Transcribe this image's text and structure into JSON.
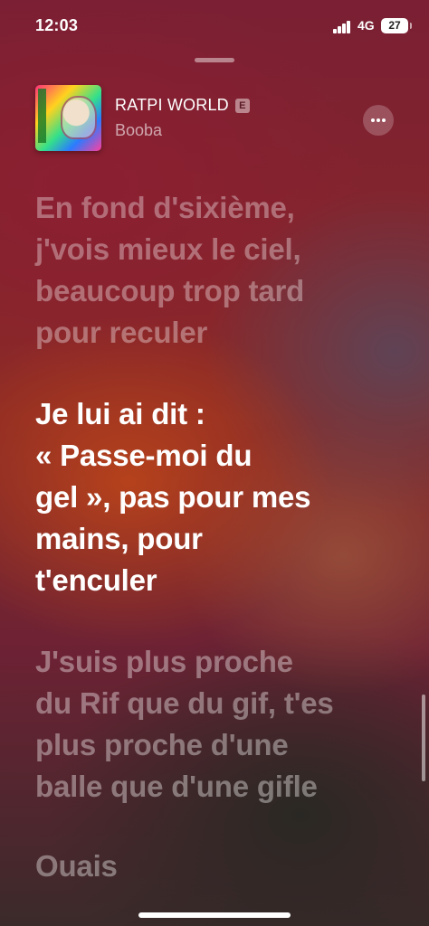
{
  "status_bar": {
    "time": "12:03",
    "network": "4G",
    "battery": "27"
  },
  "now_playing": {
    "album_title": "RATPI WORLD",
    "explicit_badge": "E",
    "artist": "Booba"
  },
  "lyrics": {
    "past_line": "En fond d'sixième,\nj'vois mieux le ciel,\nbeaucoup trop tard\npour reculer",
    "active_line": "Je lui ai dit :\n« Passe-moi du\ngel », pas pour mes\nmains, pour\nt'enculer",
    "next_line": "J'suis plus proche\ndu Rif que du gif, t'es\nplus proche d'une\nballe que d'une gifle",
    "next_line_2": "Ouais"
  },
  "icons": {
    "more": "ellipsis-icon",
    "signal": "cellular-signal-icon",
    "battery": "battery-icon",
    "album_art": "album-artwork"
  }
}
